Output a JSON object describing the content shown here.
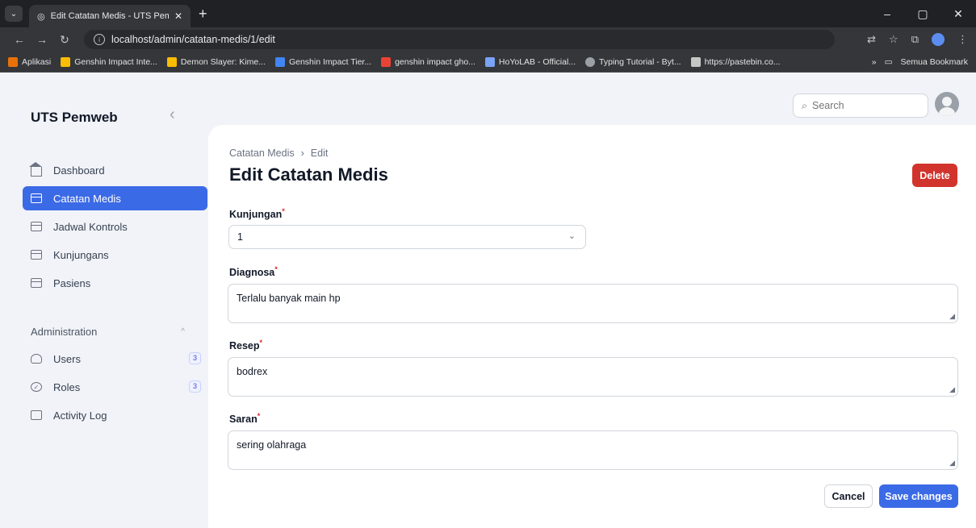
{
  "browser": {
    "tab_title": "Edit Catatan Medis - UTS Pemw",
    "url": "localhost/admin/catatan-medis/1/edit",
    "bookmarks": [
      {
        "label": "Aplikasi",
        "color": "#e8710a"
      },
      {
        "label": "Genshin Impact Inte...",
        "color": "#fbbc04"
      },
      {
        "label": "Demon Slayer: Kime...",
        "color": "#fbbc04"
      },
      {
        "label": "Genshin Impact Tier...",
        "color": "#4285f4"
      },
      {
        "label": "genshin impact gho...",
        "color": "#ea4335"
      },
      {
        "label": "HoYoLAB - Official...",
        "color": "#7aa2f7"
      },
      {
        "label": "Typing Tutorial - Byt...",
        "color": "#9aa0a6"
      },
      {
        "label": "https://pastebin.co...",
        "color": "#c4c7c5"
      }
    ],
    "bookmarks_overflow": "»",
    "all_bookmarks": "Semua Bookmark"
  },
  "sidebar": {
    "brand": "UTS Pemweb",
    "items": [
      {
        "label": "Dashboard"
      },
      {
        "label": "Catatan Medis"
      },
      {
        "label": "Jadwal Kontrols"
      },
      {
        "label": "Kunjungans"
      },
      {
        "label": "Pasiens"
      }
    ],
    "group": {
      "label": "Administration",
      "items": [
        {
          "label": "Users",
          "badge": "3"
        },
        {
          "label": "Roles",
          "badge": "3"
        },
        {
          "label": "Activity Log"
        }
      ]
    }
  },
  "topbar": {
    "search_placeholder": "Search"
  },
  "page": {
    "breadcrumb": [
      "Catatan Medis",
      "Edit"
    ],
    "title": "Edit Catatan Medis",
    "delete_label": "Delete",
    "fields": {
      "kunjungan": {
        "label": "Kunjungan",
        "value": "1"
      },
      "diagnosa": {
        "label": "Diagnosa",
        "value": "Terlalu banyak main hp"
      },
      "resep": {
        "label": "Resep",
        "value": "bodrex"
      },
      "saran": {
        "label": "Saran",
        "value": "sering olahraga"
      }
    },
    "cancel_label": "Cancel",
    "save_label": "Save changes"
  }
}
